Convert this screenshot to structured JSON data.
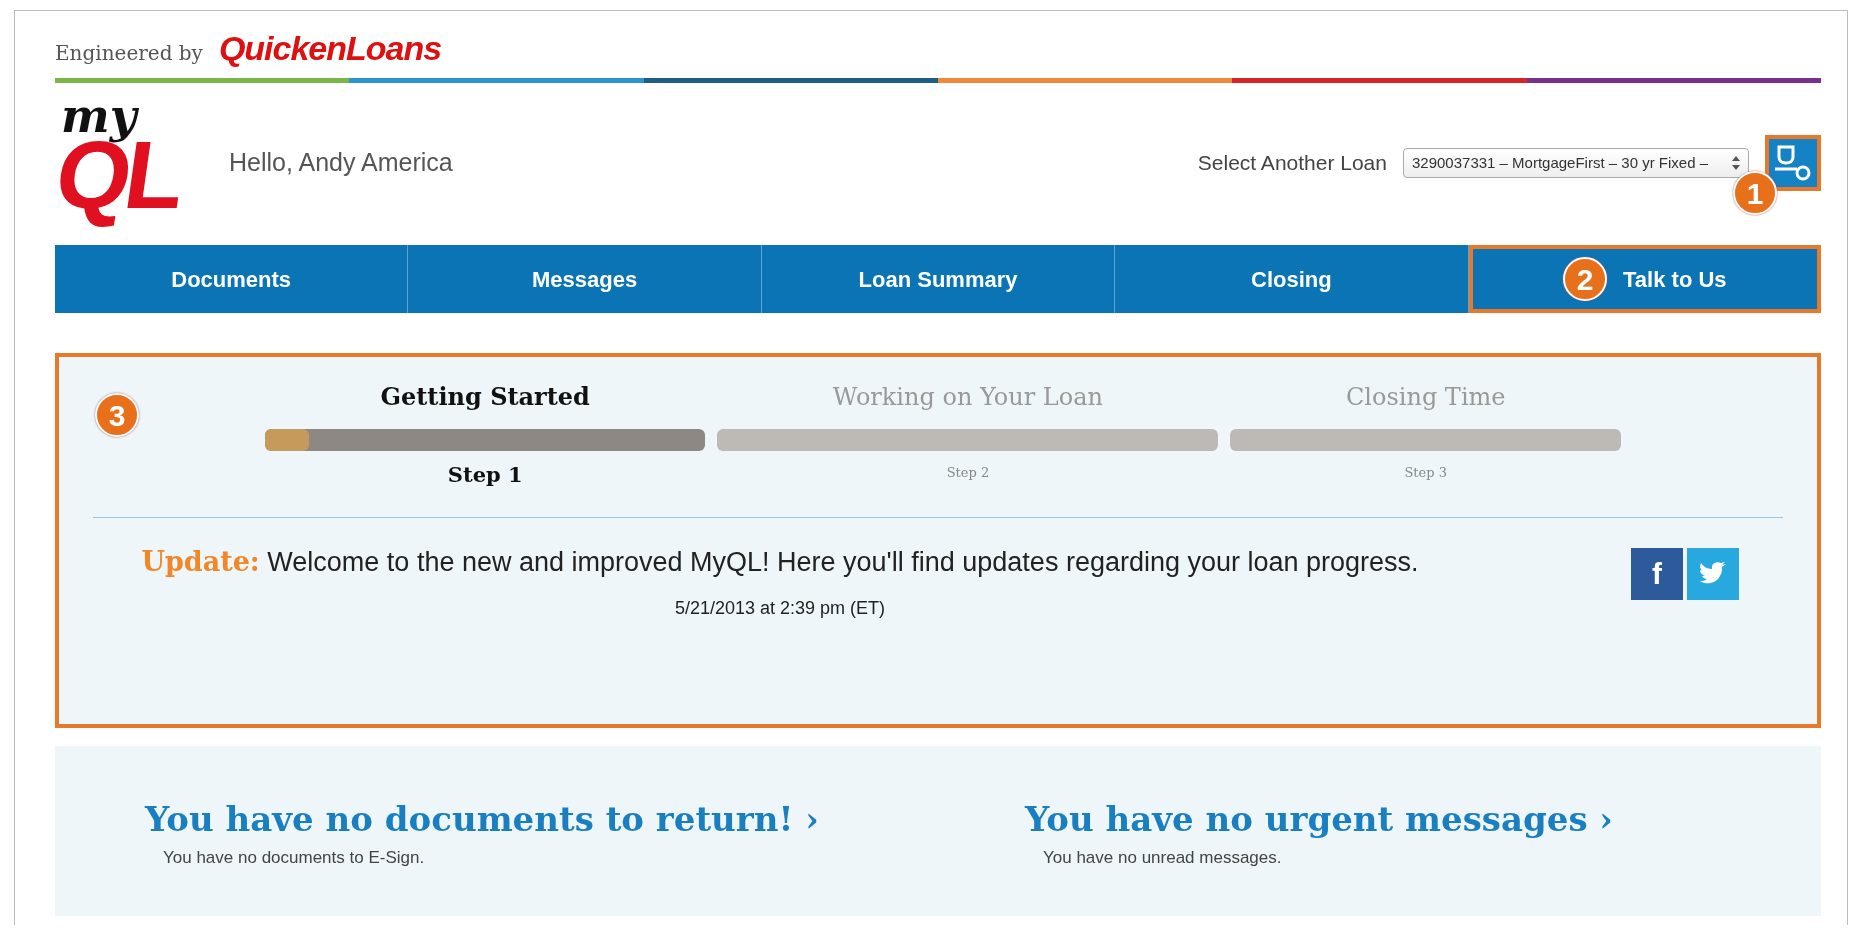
{
  "header": {
    "engineered_by": "Engineered by",
    "brand": "QuickenLoans",
    "logo_top": "my",
    "logo_main": "QL",
    "greeting": "Hello, Andy America",
    "loan_select_label": "Select Another Loan",
    "loan_select_value": "3290037331 – MortgageFirst – 30 yr Fixed –",
    "user_callout": "1"
  },
  "nav": [
    {
      "label": "Documents"
    },
    {
      "label": "Messages"
    },
    {
      "label": "Loan Summary"
    },
    {
      "label": "Closing"
    },
    {
      "label": "Talk to Us",
      "callout": "2"
    }
  ],
  "progress": {
    "callout": "3",
    "steps": [
      {
        "title": "Getting Started",
        "step": "Step 1",
        "selected": true,
        "level": 0.1
      },
      {
        "title": "Working on Your Loan",
        "step": "Step 2",
        "selected": false
      },
      {
        "title": "Closing Time",
        "step": "Step 3",
        "selected": false
      }
    ],
    "update": {
      "label": "Update:",
      "message": "Welcome to the new and improved MyQL! Here you'll find updates regarding your loan progress.",
      "time": "5/21/2013 at 2:39 pm (ET)"
    },
    "social": [
      {
        "kind": "facebook",
        "text": "f"
      },
      {
        "kind": "twitter"
      }
    ]
  },
  "summary": [
    {
      "title": "You have no documents to return! ›",
      "note": "You have no documents to E-Sign."
    },
    {
      "title": "You have no urgent messages ›",
      "note": "You have no unread messages."
    }
  ]
}
